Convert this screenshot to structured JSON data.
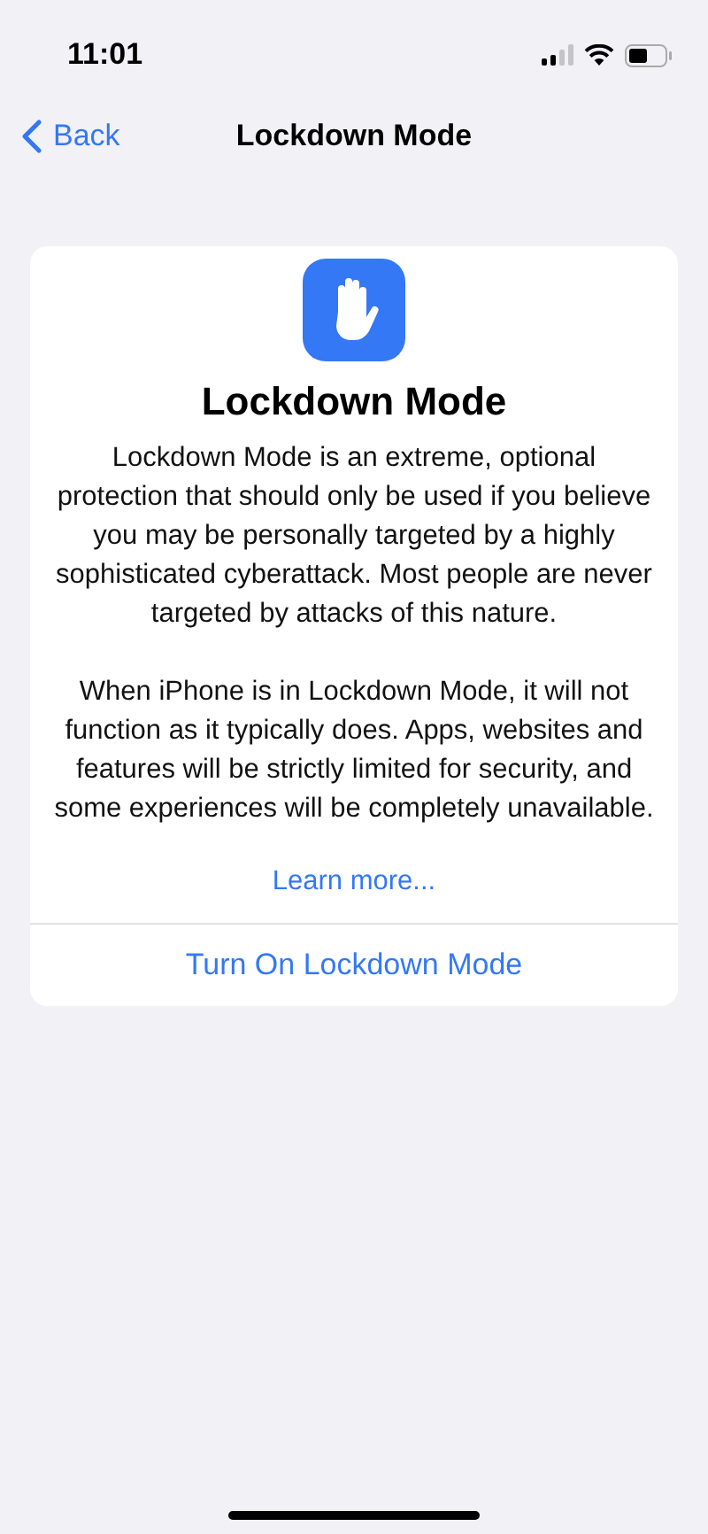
{
  "status_bar": {
    "time": "11:01"
  },
  "nav": {
    "back": "Back",
    "title": "Lockdown Mode"
  },
  "card": {
    "title": "Lockdown Mode",
    "paragraphs": [
      "Lockdown Mode is an extreme, optional protection that should only be used if you believe you may be personally targeted by a highly sophisticated cyberattack. Most people are never targeted by attacks of this nature.",
      "When iPhone is in Lockdown Mode, it will not function as it typically does. Apps, websites and features will be strictly limited for security, and some experiences will be completely unavailable."
    ],
    "link": "Learn more...",
    "action": "Turn On Lockdown Mode"
  }
}
